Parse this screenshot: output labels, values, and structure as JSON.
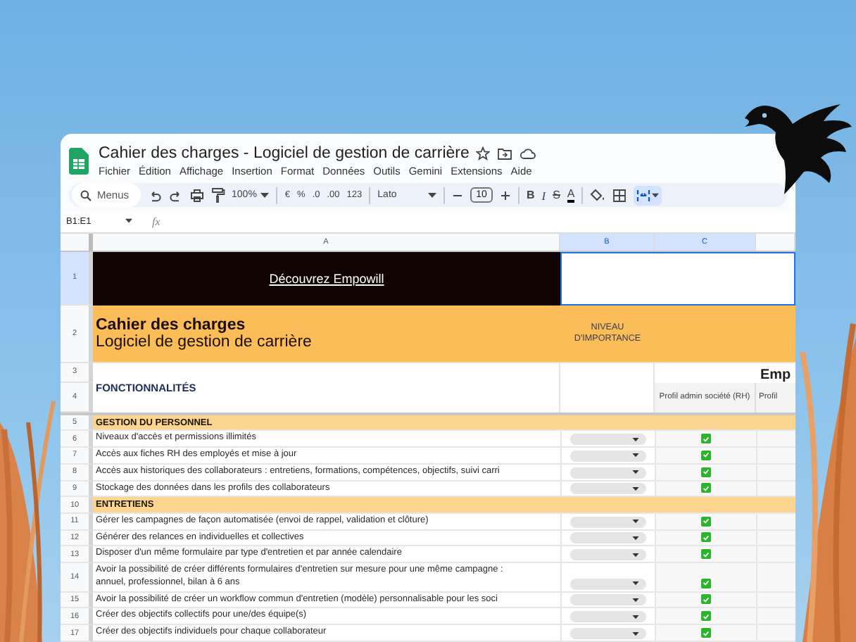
{
  "window": {
    "title": "Cahier des charges - Logiciel de gestion de carrière"
  },
  "menu": [
    "Fichier",
    "Édition",
    "Affichage",
    "Insertion",
    "Format",
    "Données",
    "Outils",
    "Gemini",
    "Extensions",
    "Aide"
  ],
  "toolbar": {
    "search_placeholder": "Menus",
    "zoom": "100%",
    "currency": "€",
    "percent": "%",
    "decrease_decimals": ".0",
    "increase_decimals": ".00",
    "number_format": "123",
    "font": "Lato",
    "font_size": "10",
    "bold": "B",
    "italic": "I",
    "strike": "S",
    "text_color": "A"
  },
  "formula_bar": {
    "cell_ref": "B1:E1",
    "fx": "fx"
  },
  "columns": [
    {
      "label": "A",
      "selected": false
    },
    {
      "label": "B",
      "selected": true
    },
    {
      "label": "C",
      "selected": true
    }
  ],
  "row_numbers": [
    {
      "label": "1",
      "selected": true
    },
    {
      "label": "2",
      "selected": false
    },
    {
      "label": "3",
      "selected": false
    },
    {
      "label": "4",
      "selected": false
    }
  ],
  "sheet": {
    "banner": "Découvrez Empowill",
    "title": "Cahier des charges",
    "subtitle": "Logiciel de gestion de carrière",
    "importance_header": "NIVEAU D'IMPORTANCE",
    "features_header": "FONCTIONNALITÉS",
    "group_header": "Emp",
    "profile_headers": [
      "Profil admin société (RH)",
      "Profil"
    ]
  },
  "rows": [
    {
      "number": "5",
      "kind": "section",
      "text": "GESTION DU PERSONNEL"
    },
    {
      "number": "6",
      "kind": "item",
      "text": "Niveaux d'accès et permissions illimités",
      "checked": true
    },
    {
      "number": "7",
      "kind": "item",
      "text": "Accès aux fiches RH des employés et mise à jour",
      "checked": true
    },
    {
      "number": "8",
      "kind": "item",
      "text": "Accès aux historiques des collaborateurs : entretiens, formations, compétences, objectifs, suivi carri",
      "checked": true
    },
    {
      "number": "9",
      "kind": "item",
      "text": "Stockage des données dans les profils des collaborateurs",
      "checked": true
    },
    {
      "number": "10",
      "kind": "section",
      "text": "ENTRETIENS"
    },
    {
      "number": "11",
      "kind": "item",
      "text": "Gérer les campagnes de façon automatisée (envoi de rappel, validation et clôture)",
      "checked": true
    },
    {
      "number": "12",
      "kind": "item",
      "text": "Générer des relances en individuelles et collectives",
      "checked": true
    },
    {
      "number": "13",
      "kind": "item",
      "text": "Disposer d'un même formulaire par type d'entretien et par année calendaire",
      "checked": true
    },
    {
      "number": "14",
      "kind": "item",
      "text": "Avoir la possibilité de créer différents formulaires d'entretien sur mesure pour une même campagne : annuel, professionnel, bilan à 6 ans",
      "checked": true
    },
    {
      "number": "15",
      "kind": "item",
      "text": "Avoir la possibilité de créer un workflow commun d'entretien (modèle) personnalisable pour les soci",
      "checked": true
    },
    {
      "number": "16",
      "kind": "item",
      "text": "Créer des objectifs collectifs pour une/des équipe(s)",
      "checked": true
    },
    {
      "number": "17",
      "kind": "item",
      "text": "Créer des objectifs individuels pour chaque collaborateur",
      "checked": true
    }
  ]
}
